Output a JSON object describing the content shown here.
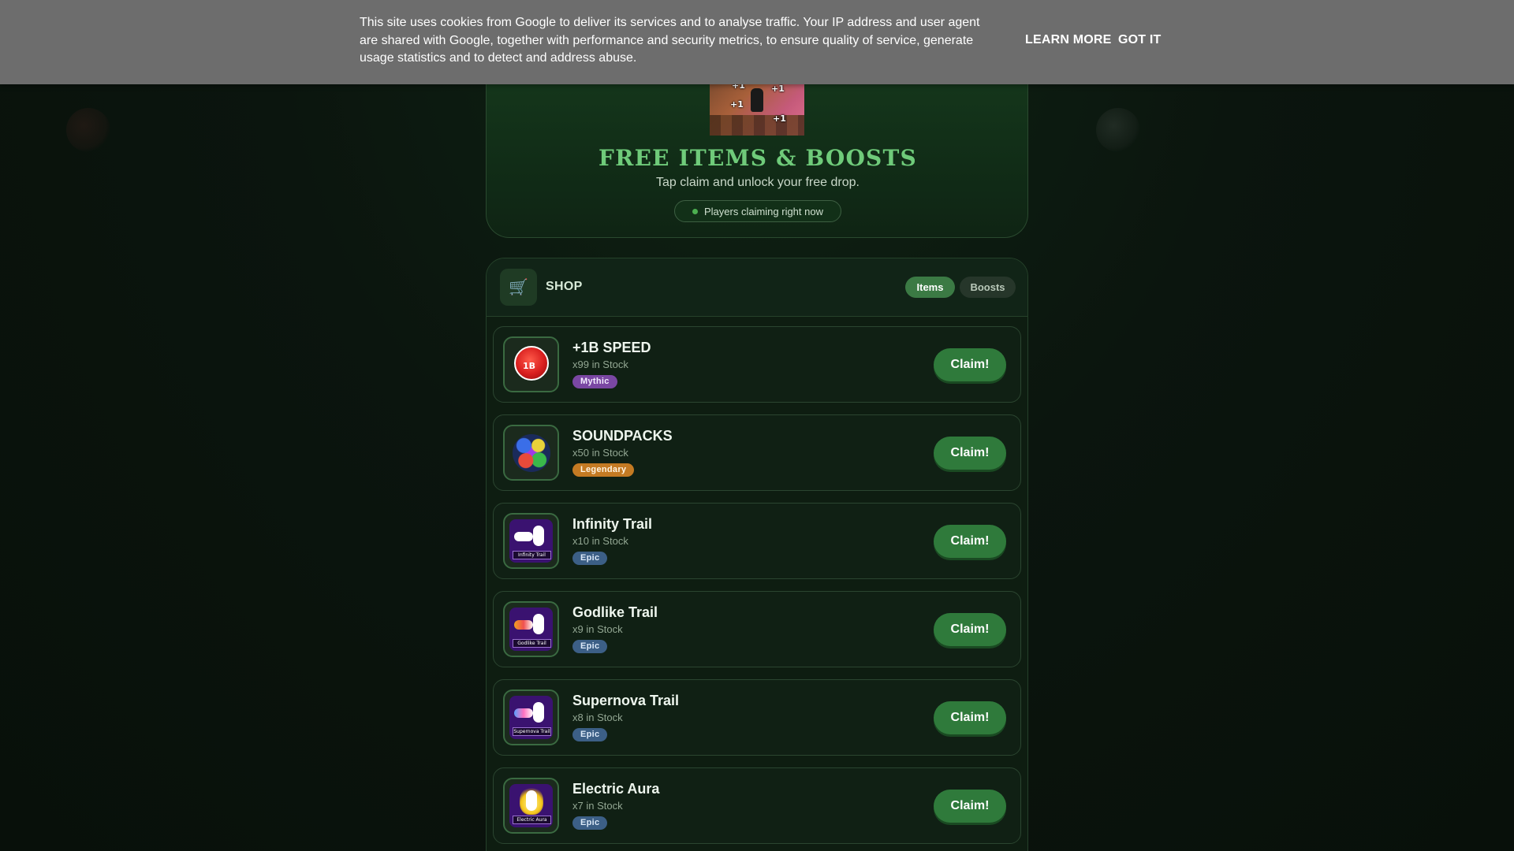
{
  "cookie_banner": {
    "text": "This site uses cookies from Google to deliver its services and to analyse traffic. Your IP address and user agent are shared with Google, together with performance and security metrics, to ensure quality of service, generate usage statistics and to detect and address abuse.",
    "learn_more": "LEARN MORE",
    "got_it": "GOT IT"
  },
  "hero": {
    "image_badges": [
      "+1",
      "+1",
      "+1",
      "+1"
    ],
    "title": "FREE ITEMS & BOOSTS",
    "subtitle": "Tap claim and unlock your free drop.",
    "live_label": "Players claiming right now"
  },
  "shop": {
    "icon": "cart-icon",
    "title": "SHOP",
    "tabs": [
      {
        "label": "Items",
        "active": true
      },
      {
        "label": "Boosts",
        "active": false
      }
    ],
    "claim_label": "Claim!",
    "items": [
      {
        "name": "+1B SPEED",
        "stock": "x99 in Stock",
        "rarity": "Mythic",
        "icon": "speed-orb-icon",
        "icon_text": "1B"
      },
      {
        "name": "SOUNDPACKS",
        "stock": "x50 in Stock",
        "rarity": "Legendary",
        "icon": "soundpacks-icon"
      },
      {
        "name": "Infinity Trail",
        "stock": "x10 in Stock",
        "rarity": "Epic",
        "icon": "infinity-trail-icon",
        "icon_text": "Infinity Trail"
      },
      {
        "name": "Godlike Trail",
        "stock": "x9 in Stock",
        "rarity": "Epic",
        "icon": "godlike-trail-icon",
        "icon_text": "Godlike Trail"
      },
      {
        "name": "Supernova Trail",
        "stock": "x8 in Stock",
        "rarity": "Epic",
        "icon": "supernova-trail-icon",
        "icon_text": "Supernova Trail"
      },
      {
        "name": "Electric Aura",
        "stock": "x7 in Stock",
        "rarity": "Epic",
        "icon": "electric-aura-icon",
        "icon_text": "Electric Aura"
      }
    ]
  },
  "colors": {
    "accent_green": "#2f7a3b",
    "title_green": "#6fcb7a",
    "mythic": "#7a47a3",
    "legendary": "#c47a23",
    "epic": "#3c5f86",
    "cookie_bar": "#6d6d6d"
  }
}
